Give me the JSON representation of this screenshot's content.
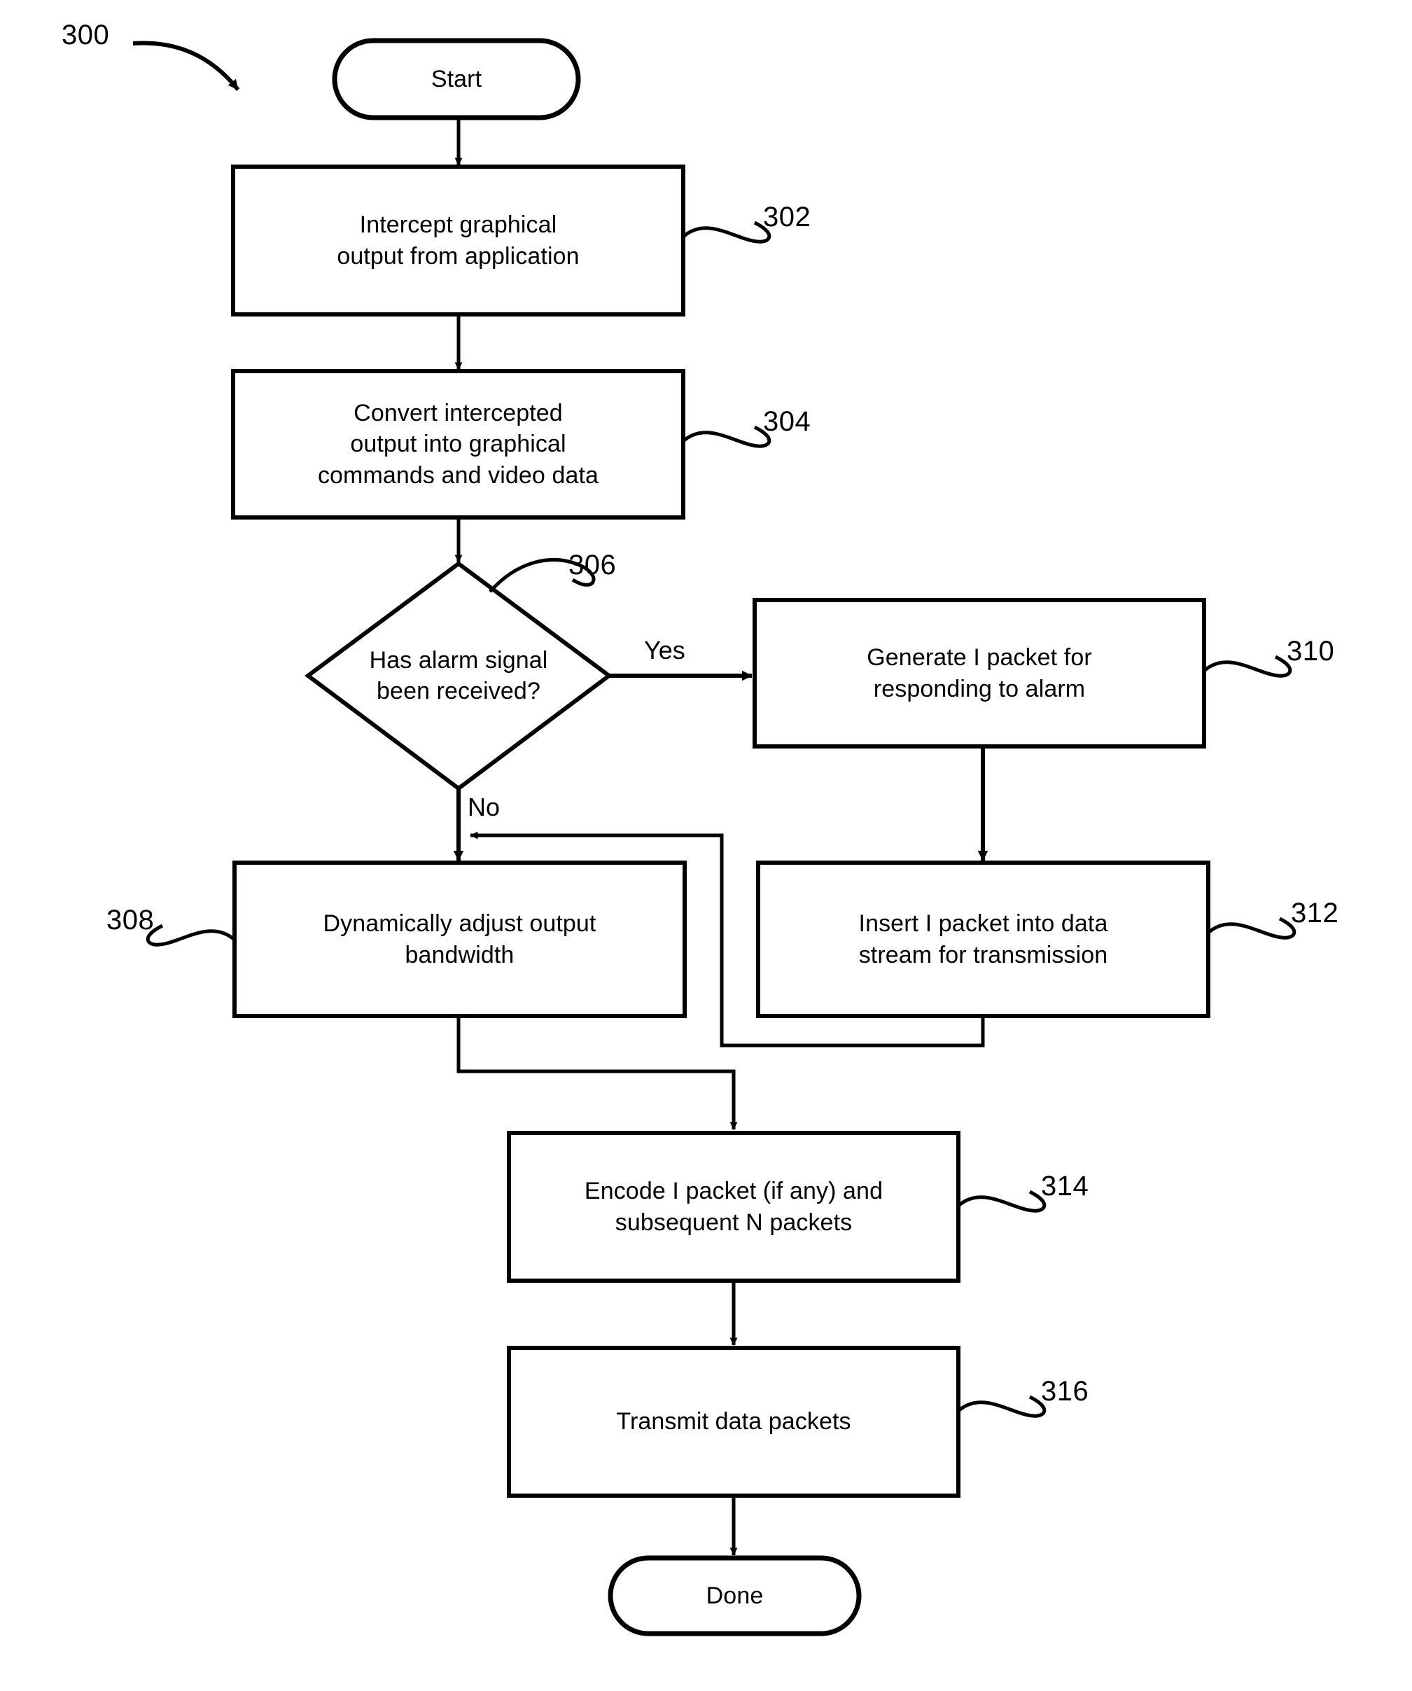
{
  "figure": {
    "reference_numeral": "300"
  },
  "nodes": {
    "start": {
      "label": "Start",
      "shape": "terminator"
    },
    "intercept": {
      "label": "Intercept graphical\noutput from application",
      "ref": "302",
      "shape": "process"
    },
    "convert": {
      "label": "Convert intercepted\noutput into graphical\ncommands and video data",
      "ref": "304",
      "shape": "process"
    },
    "decision": {
      "label": "Has alarm signal\nbeen received?",
      "ref": "306",
      "shape": "decision"
    },
    "generate": {
      "label": "Generate I packet for\nresponding to alarm",
      "ref": "310",
      "shape": "process"
    },
    "adjust": {
      "label": "Dynamically adjust output\nbandwidth",
      "ref": "308",
      "shape": "process"
    },
    "insert": {
      "label": "Insert I packet into data\nstream for transmission",
      "ref": "312",
      "shape": "process"
    },
    "encode": {
      "label": "Encode I packet (if any) and\nsubsequent N packets",
      "ref": "314",
      "shape": "process"
    },
    "transmit": {
      "label": "Transmit data packets",
      "ref": "316",
      "shape": "process"
    },
    "done": {
      "label": "Done",
      "shape": "terminator"
    }
  },
  "edge_labels": {
    "yes": "Yes",
    "no": "No"
  },
  "style": {
    "stroke": "#000000",
    "fill": "#ffffff",
    "background": "#ffffff"
  }
}
